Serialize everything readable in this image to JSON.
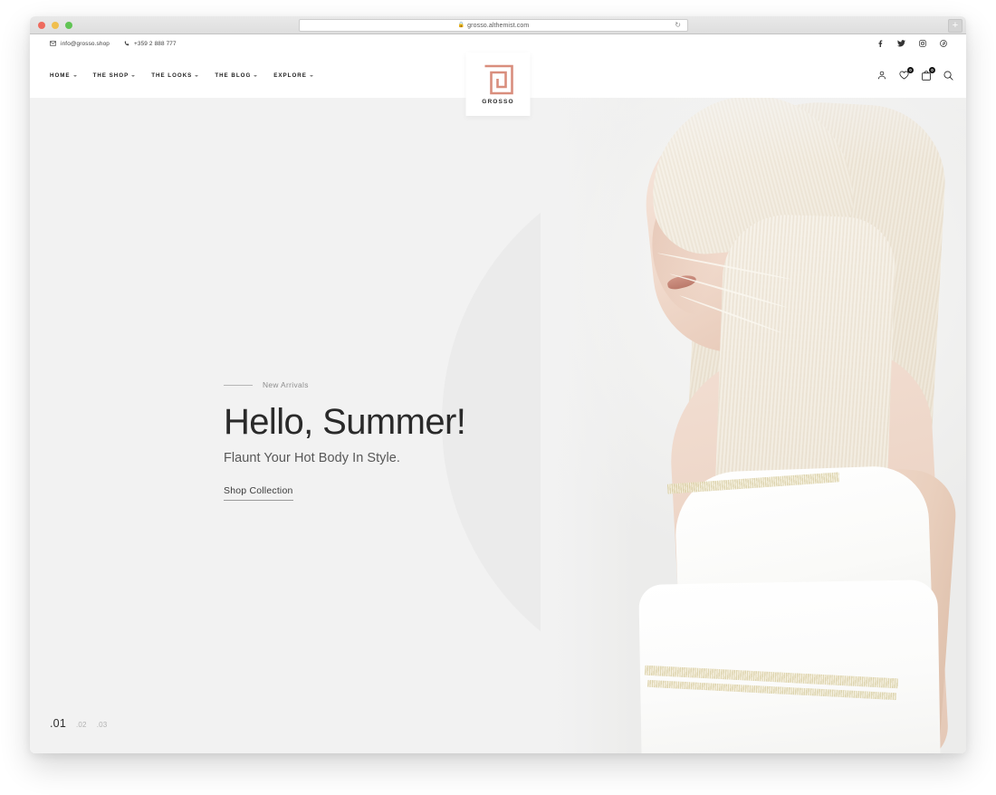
{
  "browser": {
    "url": "grosso.althemist.com",
    "lock_icon": "lock-icon",
    "reload_icon": "reload-icon",
    "new_tab_label": "+",
    "traffic_lights": [
      "close",
      "minimize",
      "maximize"
    ]
  },
  "topbar": {
    "email": "info@grosso.shop",
    "phone": "+359 2 888 777",
    "email_icon": "envelope-icon",
    "phone_icon": "phone-icon",
    "social": [
      {
        "name": "facebook-icon",
        "label": "f"
      },
      {
        "name": "twitter-icon",
        "label": "t"
      },
      {
        "name": "instagram-icon",
        "label": "ig"
      },
      {
        "name": "pinterest-icon",
        "label": "p"
      }
    ]
  },
  "header": {
    "nav": [
      {
        "label": "HOME",
        "has_dropdown": true
      },
      {
        "label": "THE SHOP",
        "has_dropdown": true
      },
      {
        "label": "THE LOOKS",
        "has_dropdown": true
      },
      {
        "label": "THE BLOG",
        "has_dropdown": true
      },
      {
        "label": "EXPLORE",
        "has_dropdown": true
      }
    ],
    "logo": {
      "text": "GROSSO",
      "mark": "spiral-g-maze-icon",
      "color": "#d98e7d"
    },
    "actions": {
      "account_icon": "user-icon",
      "wishlist_icon": "heart-icon",
      "wishlist_count": "0",
      "cart_icon": "shopping-bag-icon",
      "cart_count": "0",
      "search_icon": "search-icon"
    }
  },
  "hero": {
    "eyebrow": "New Arrivals",
    "title": "Hello, Summer!",
    "subtitle": "Flaunt Your Hot Body In Style.",
    "cta": "Shop Collection",
    "slides": [
      {
        "label": ".01",
        "active": true
      },
      {
        "label": ".02",
        "active": false
      },
      {
        "label": ".03",
        "active": false
      }
    ],
    "background_color": "#f2f2f2",
    "circle_color": "#ebebeb"
  }
}
